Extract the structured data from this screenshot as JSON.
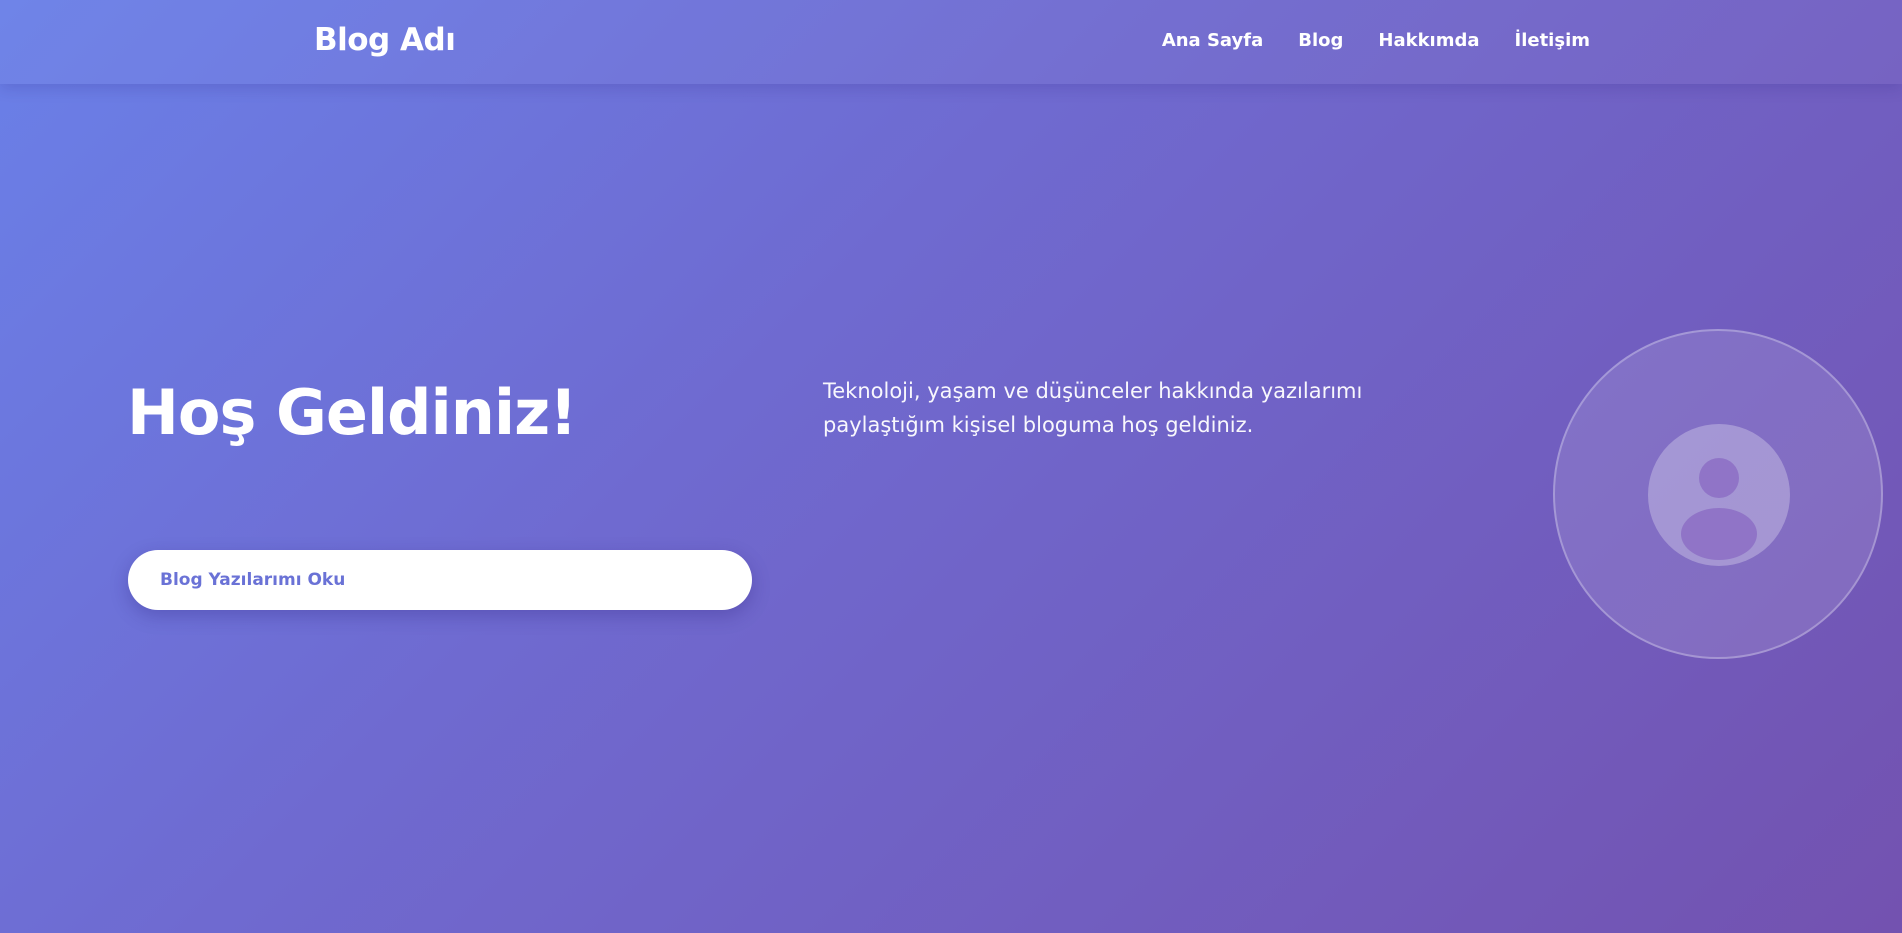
{
  "header": {
    "brand": "Blog Adı",
    "nav": [
      {
        "label": "Ana Sayfa"
      },
      {
        "label": "Blog"
      },
      {
        "label": "Hakkımda"
      },
      {
        "label": "İletişim"
      }
    ]
  },
  "hero": {
    "title": "Hoş Geldiniz!",
    "subtitle": "Teknoloji, yaşam ve düşünceler hakkında yazılarımı paylaştığım kişisel bloguma hoş geldiniz.",
    "cta_label": "Blog Yazılarımı Oku",
    "avatar_icon": "user-avatar-icon"
  },
  "colors": {
    "gradient_start": "#6a80e8",
    "gradient_end": "#7352b0",
    "cta_text": "#6a72d6",
    "cta_background": "#ffffff"
  }
}
